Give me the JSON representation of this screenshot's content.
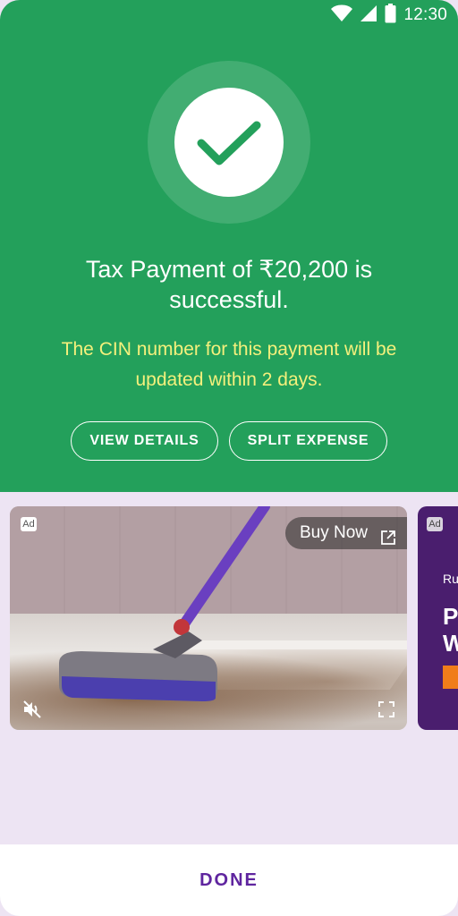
{
  "status_bar": {
    "time": "12:30",
    "icons": [
      "wifi-icon",
      "signal-icon",
      "battery-icon"
    ]
  },
  "payment": {
    "title": "Tax Payment of ₹20,200 is successful.",
    "cin_note": "The CIN number for this payment will be updated within 2 days.",
    "icon": "check-icon"
  },
  "actions": {
    "view_details": "VIEW DETAILS",
    "split_expense": "SPLIT EXPENSE"
  },
  "ads": {
    "primary": {
      "badge": "Ad",
      "cta": "Buy Now",
      "cta_icon": "external-link-icon",
      "controls": [
        "mute-icon",
        "fullscreen-icon"
      ]
    },
    "secondary": {
      "badge": "Ad",
      "text_small": "Ru",
      "text_big": "P\nW"
    }
  },
  "footer": {
    "done": "DONE"
  },
  "colors": {
    "success_green": "#23a05b",
    "note_yellow": "#f4f07c",
    "brand_purple": "#5f259f",
    "background": "#ede4f3"
  }
}
